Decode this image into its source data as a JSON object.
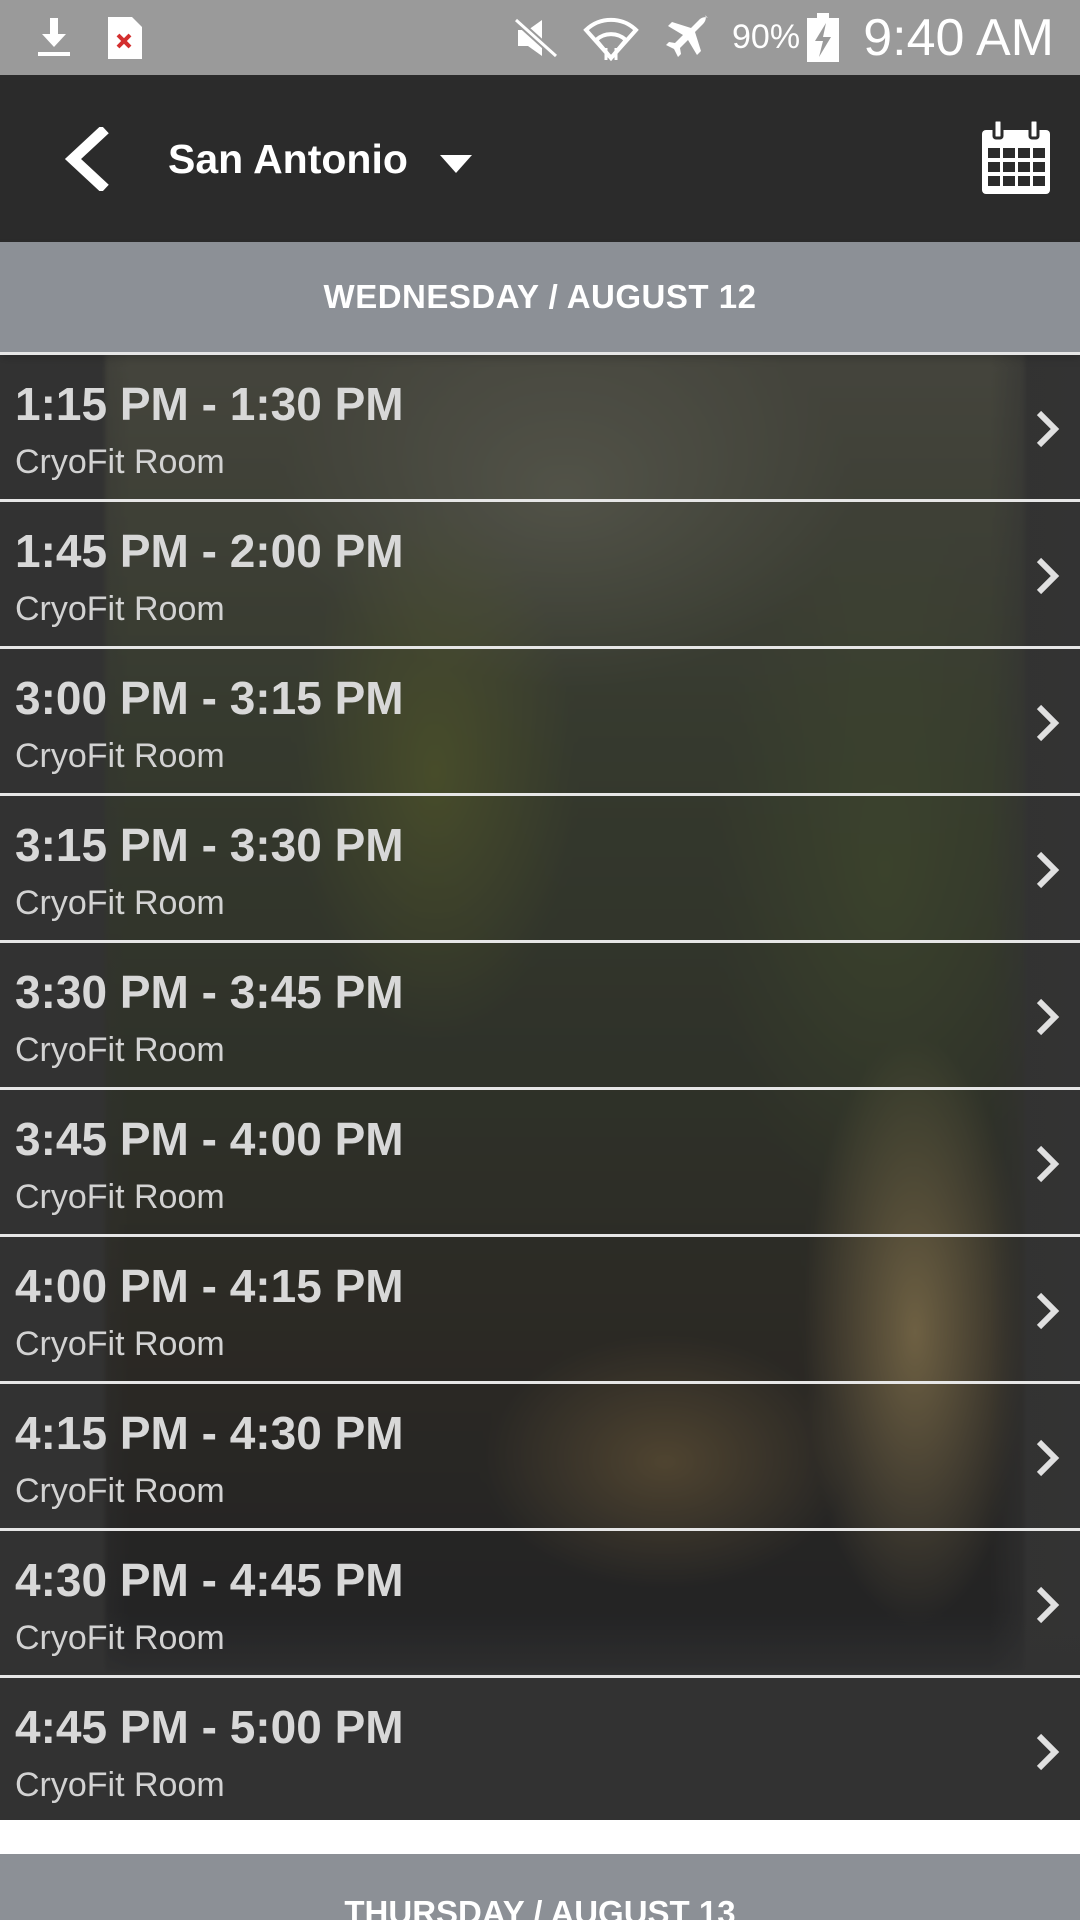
{
  "status_bar": {
    "time": "9:40 AM",
    "battery_percent": "90%",
    "icons": [
      "download-icon",
      "file-error-icon",
      "mute-icon",
      "wifi-icon",
      "airplane-icon",
      "battery-charging-icon"
    ]
  },
  "app_bar": {
    "location": "San Antonio",
    "icons": [
      "back-icon",
      "caret-down-icon",
      "calendar-icon"
    ]
  },
  "day_header": "WEDNESDAY / AUGUST 12",
  "slots": [
    {
      "time": "1:15 PM - 1:30 PM",
      "room": "CryoFit Room"
    },
    {
      "time": "1:45 PM - 2:00 PM",
      "room": "CryoFit Room"
    },
    {
      "time": "3:00 PM - 3:15 PM",
      "room": "CryoFit Room"
    },
    {
      "time": "3:15 PM - 3:30 PM",
      "room": "CryoFit Room"
    },
    {
      "time": "3:30 PM - 3:45 PM",
      "room": "CryoFit Room"
    },
    {
      "time": "3:45 PM - 4:00 PM",
      "room": "CryoFit Room"
    },
    {
      "time": "4:00 PM - 4:15 PM",
      "room": "CryoFit Room"
    },
    {
      "time": "4:15 PM - 4:30 PM",
      "room": "CryoFit Room"
    },
    {
      "time": "4:30 PM - 4:45 PM",
      "room": "CryoFit Room"
    },
    {
      "time": "4:45 PM - 5:00 PM",
      "room": "CryoFit Room"
    }
  ],
  "next_day_header": "THURSDAY / AUGUST 13",
  "colors": {
    "status_bar": "#9a9a9a",
    "app_bar": "#2b2b2b",
    "day_header": "#8c9096",
    "slot_text": "#d8d8d8",
    "divider": "#e6e6e6"
  }
}
